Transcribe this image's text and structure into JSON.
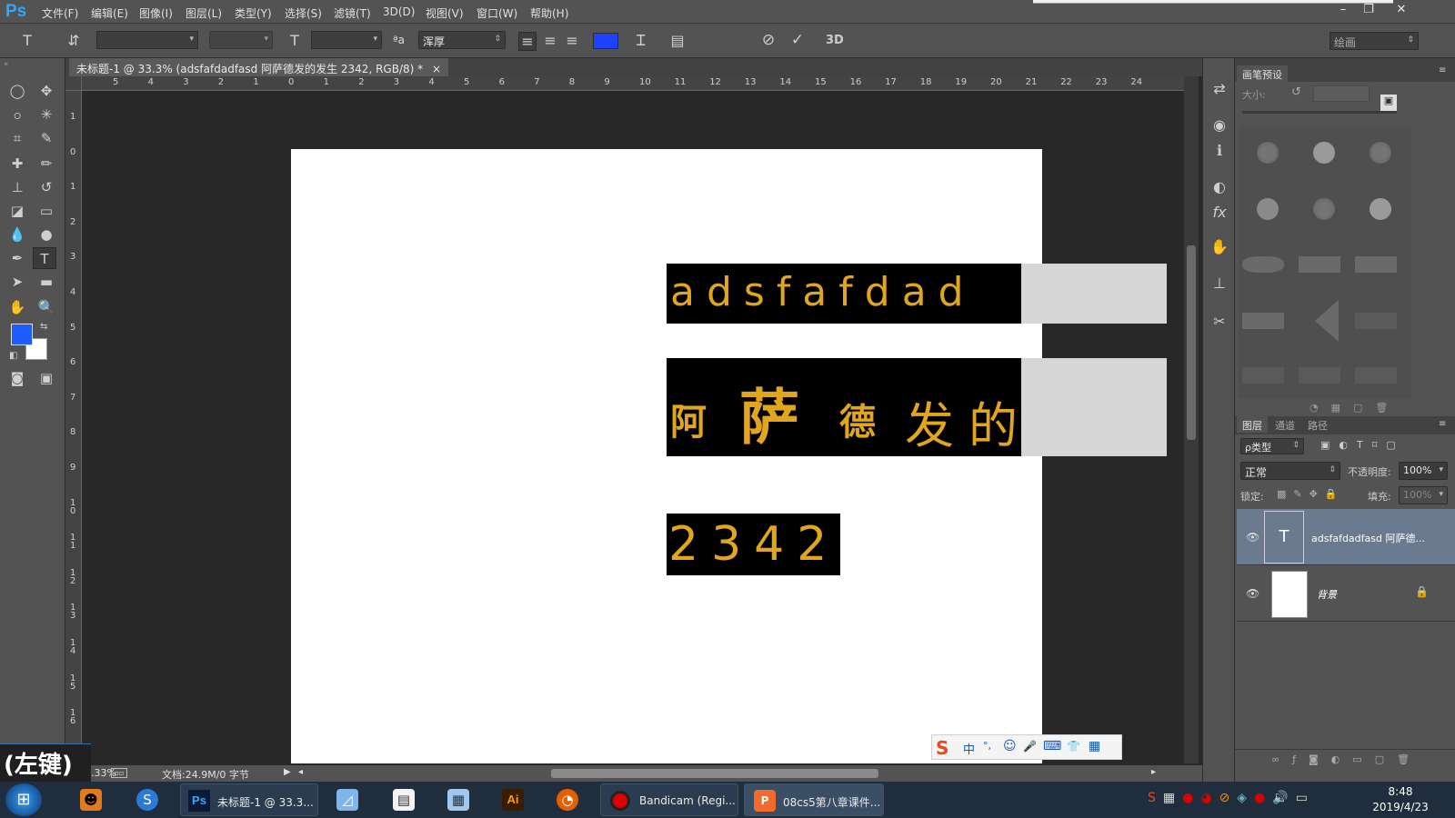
{
  "app": {
    "logo": "Ps"
  },
  "menu": [
    "文件(F)",
    "编辑(E)",
    "图像(I)",
    "图层(L)",
    "类型(Y)",
    "选择(S)",
    "滤镜(T)",
    "3D(D)",
    "视图(V)",
    "窗口(W)",
    "帮助(H)"
  ],
  "window_controls": {
    "minimize": "–",
    "restore": "❐",
    "close": "✕"
  },
  "options": {
    "aa_label": "ªa",
    "aa_value": "浑厚",
    "text_color": "#1e40ff",
    "cancel_glyph": "⊘",
    "commit_glyph": "✓",
    "threed": "3D",
    "workspace": "绘画"
  },
  "document": {
    "tab_title": "未标题-1 @ 33.3% (adsfafdadfasd  阿萨德发的发生 2342, RGB/8) *",
    "tab_close": "×",
    "zoom": "33.33%",
    "doc_size": "文档:24.9M/0 字节"
  },
  "ruler": {
    "top": [
      "5",
      "4",
      "3",
      "2",
      "1",
      "0",
      "1",
      "2",
      "3",
      "4",
      "5",
      "6",
      "7",
      "8",
      "9",
      "10",
      "11",
      "12",
      "13",
      "14",
      "15",
      "16",
      "17",
      "18",
      "19",
      "20",
      "21",
      "22",
      "23",
      "24"
    ],
    "left": [
      "1",
      "0",
      "1",
      "2",
      "3",
      "4",
      "5",
      "6",
      "7",
      "8",
      "9",
      "10",
      "11",
      "12",
      "13",
      "14",
      "15",
      "16"
    ]
  },
  "canvas_text": {
    "line1": "adsfafdad",
    "line2_chars": [
      "阿",
      "萨",
      "德",
      "发",
      "的"
    ],
    "line3": "2342"
  },
  "brush_panel": {
    "tab": "画笔预设",
    "size_label": "大小:"
  },
  "layers_panel": {
    "tabs": [
      "图层",
      "通道",
      "路径"
    ],
    "filter": "ρ类型",
    "blend_mode": "正常",
    "opacity_label": "不透明度:",
    "opacity_value": "100%",
    "lock_label": "锁定:",
    "fill_label": "填充:",
    "fill_value": "100%",
    "layers": [
      {
        "name": "adsfafdadfasd 阿萨德...",
        "thumb": "T"
      },
      {
        "name": "背景",
        "thumb": ""
      }
    ]
  },
  "overlay": {
    "mouse_hint": "(左键)"
  },
  "ime": {
    "items": [
      "中",
      "°,",
      "☺",
      "🎤",
      "⌨",
      "👕",
      "▦"
    ]
  },
  "taskbar": {
    "buttons": [
      "未标题-1 @ 33.3...",
      "Bandicam (Regi...",
      "08cs5第八章课件..."
    ],
    "ai_label": "Ai",
    "time": "8:48",
    "date": "2019/4/23"
  },
  "colors": {
    "foreground": "#1e5cff",
    "background": "#ffffff",
    "accent": "#e0a71e"
  }
}
